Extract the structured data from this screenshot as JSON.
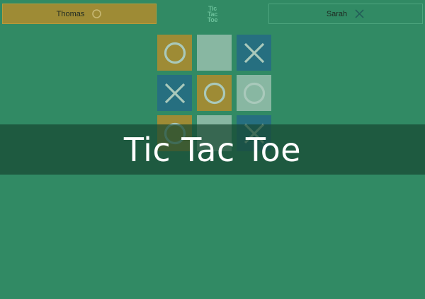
{
  "players": [
    {
      "name": "Thomas",
      "mark": "o",
      "mark_icon": "circle-icon",
      "active": true
    },
    {
      "name": "Sarah",
      "mark": "x",
      "mark_icon": "cross-icon",
      "active": false
    }
  ],
  "logo": {
    "lines": [
      "Tic",
      "Tac",
      "Toe"
    ]
  },
  "board": {
    "cells": [
      "o",
      "",
      "x",
      "x",
      "o",
      "o",
      "o",
      "",
      "x"
    ]
  },
  "banner": {
    "title": "Tic Tac Toe"
  },
  "colors": {
    "background": "#318a64",
    "o_tile": "#9e8b35",
    "x_tile": "#266f80",
    "empty_tile": "#88b7a2",
    "mark_stroke": "#a9c9bb",
    "banner": "#184832"
  }
}
